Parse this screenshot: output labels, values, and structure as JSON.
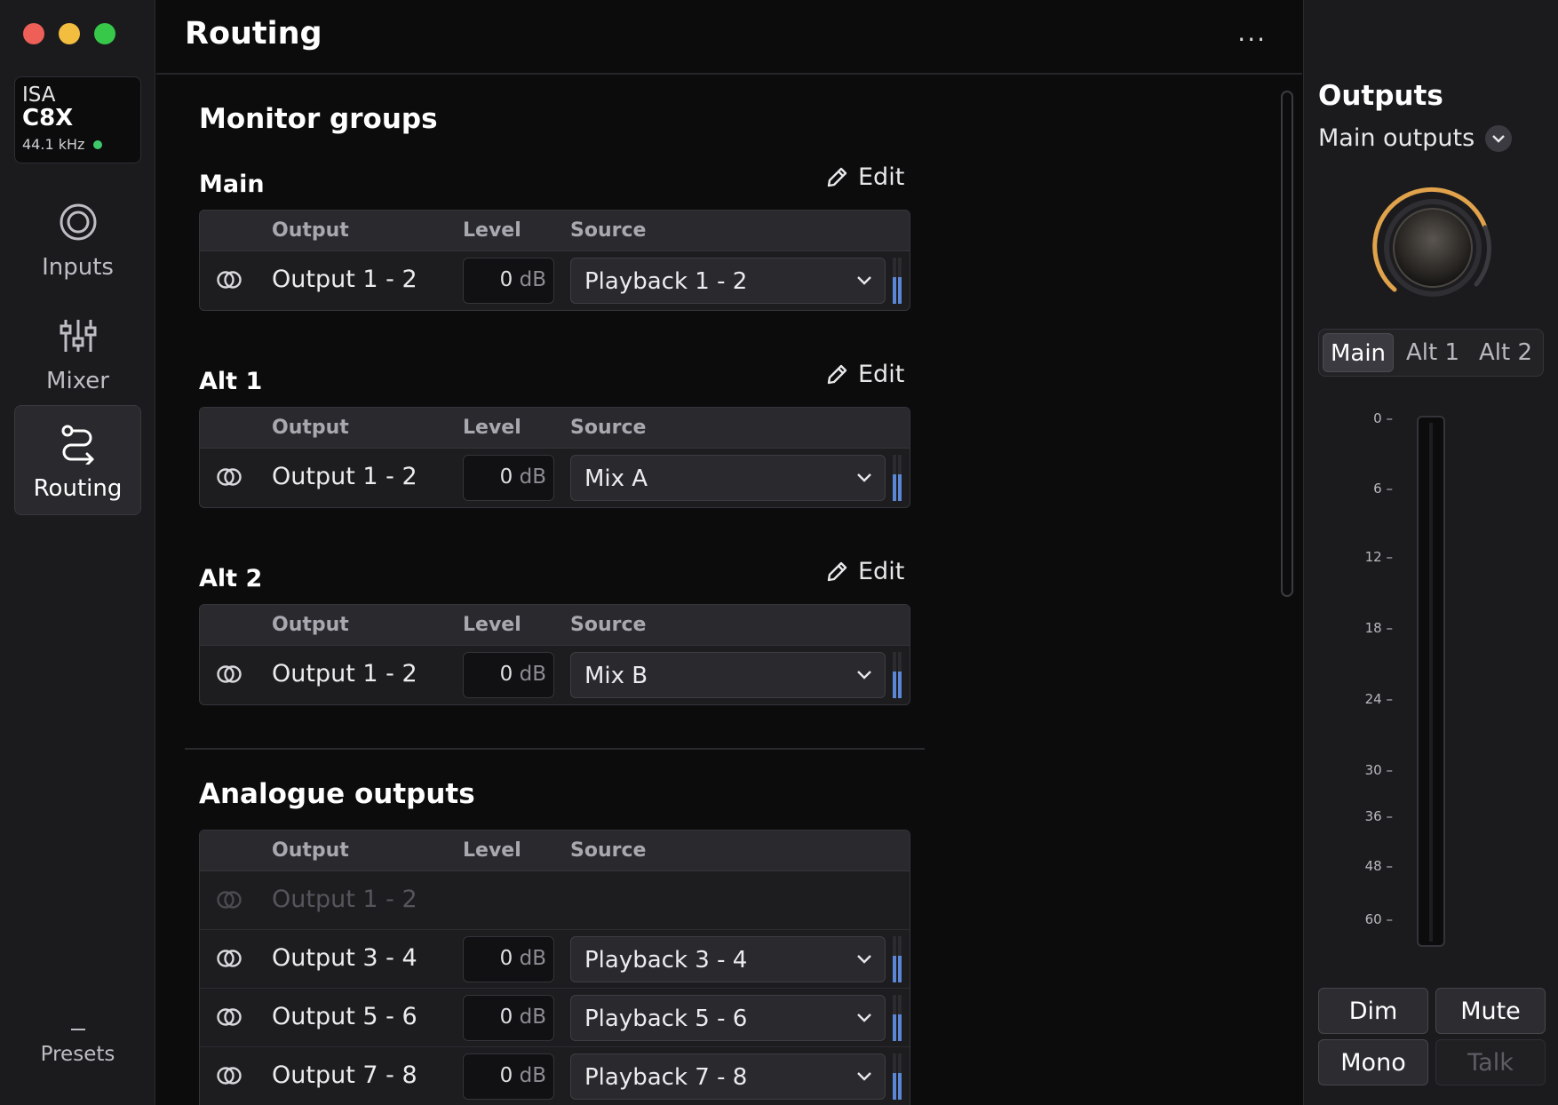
{
  "sidebar": {
    "device": {
      "brand": "ISA",
      "model": "C8X",
      "sample_rate": "44.1 kHz"
    },
    "nav": [
      {
        "label": "Inputs",
        "icon": "inputs-icon"
      },
      {
        "label": "Mixer",
        "icon": "mixer-icon"
      },
      {
        "label": "Routing",
        "icon": "routing-icon",
        "active": true
      }
    ],
    "presets_label": "Presets"
  },
  "header": {
    "title": "Routing",
    "more": "···"
  },
  "monitor_groups": {
    "title": "Monitor groups",
    "edit_label": "Edit",
    "columns": {
      "output": "Output",
      "level": "Level",
      "source": "Source"
    },
    "groups": [
      {
        "name": "Main",
        "output": "Output 1 - 2",
        "level": "0",
        "unit": "dB",
        "source": "Playback 1 - 2"
      },
      {
        "name": "Alt 1",
        "output": "Output 1 - 2",
        "level": "0",
        "unit": "dB",
        "source": "Mix A"
      },
      {
        "name": "Alt 2",
        "output": "Output 1 - 2",
        "level": "0",
        "unit": "dB",
        "source": "Mix B"
      }
    ]
  },
  "analogue_outputs": {
    "title": "Analogue outputs",
    "columns": {
      "output": "Output",
      "level": "Level",
      "source": "Source"
    },
    "rows": [
      {
        "output": "Output 1 - 2",
        "disabled": true
      },
      {
        "output": "Output 3 - 4",
        "level": "0",
        "unit": "dB",
        "source": "Playback 3 - 4"
      },
      {
        "output": "Output 5 - 6",
        "level": "0",
        "unit": "dB",
        "source": "Playback 5 - 6"
      },
      {
        "output": "Output 7 - 8",
        "level": "0",
        "unit": "dB",
        "source": "Playback 7 - 8"
      }
    ]
  },
  "outputs_panel": {
    "title": "Outputs",
    "selected": "Main outputs",
    "tabs": [
      {
        "label": "Main",
        "active": true
      },
      {
        "label": "Alt 1"
      },
      {
        "label": "Alt 2"
      }
    ],
    "scale": [
      "0",
      "6",
      "12",
      "18",
      "24",
      "30",
      "36",
      "48",
      "60"
    ],
    "buttons": {
      "dim": "Dim",
      "mute": "Mute",
      "mono": "Mono",
      "talk": "Talk"
    }
  },
  "colors": {
    "accent_knob": "#e0a24a",
    "meter": "#5b86d6",
    "status_ok": "#3ec96b"
  }
}
